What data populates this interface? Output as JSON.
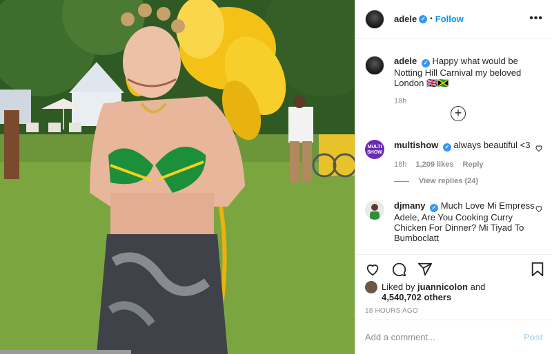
{
  "header": {
    "username": "adele",
    "dot": "•",
    "follow_label": "Follow",
    "more_label": "•••"
  },
  "caption": {
    "username": "adele",
    "text": "Happy what would be Notting Hill Carnival my beloved London 🇬🇧🇯🇲",
    "time": "18h"
  },
  "load_more_label": "+",
  "comments": [
    {
      "username": "multishow",
      "avatar_text": "MULTI SHOW",
      "text": "always beautiful <3",
      "time": "18h",
      "likes": "1,209 likes",
      "reply_label": "Reply",
      "view_replies": "View replies (24)"
    },
    {
      "username": "djmany",
      "text": "Much Love Mi Empress Adele, Are You Cooking Curry Chicken For Dinner? Mi Tiyad To Bumboclatt"
    }
  ],
  "likes": {
    "prefix": "Liked by",
    "user": "juannicolon",
    "and": "and",
    "others": "4,540,702 others"
  },
  "timestamp": "18 HOURS AGO",
  "comment_box": {
    "placeholder": "Add a comment...",
    "post_label": "Post"
  },
  "colors": {
    "accent": "#0095f6",
    "verified": "#3897f0",
    "post_disabled": "#b2dffc"
  },
  "icons": [
    "heart-icon",
    "comment-icon",
    "share-icon",
    "bookmark-icon",
    "more-icon",
    "verified-icon",
    "plus-icon"
  ]
}
